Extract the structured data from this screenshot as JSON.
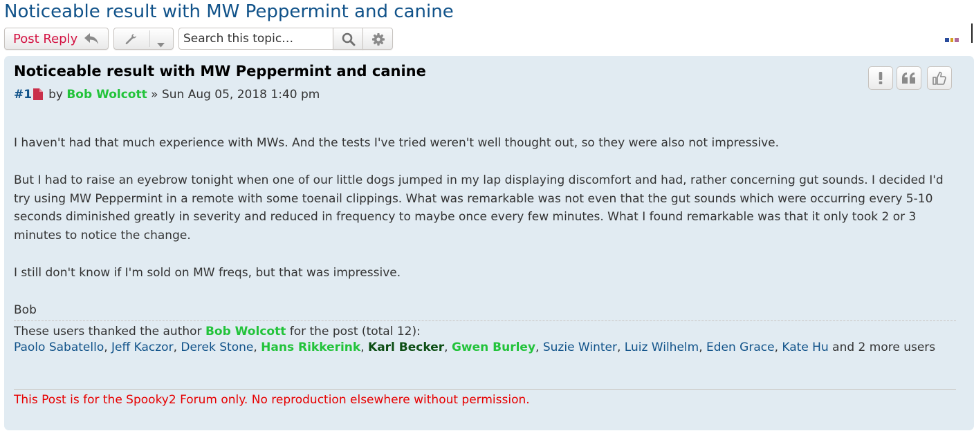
{
  "topic": {
    "title": "Noticeable result with MW Peppermint and canine"
  },
  "toolbar": {
    "post_reply_label": "Post Reply",
    "reply_icon": "reply-arrow-icon",
    "tools_icon": "wrench-icon",
    "search_placeholder": "Search this topic…",
    "search_icon": "magnifier-icon",
    "advanced_search_icon": "gear-icon"
  },
  "post": {
    "title": "Noticeable result with MW Peppermint and canine",
    "number": "#1",
    "by_label": "by",
    "author": "Bob Wolcott",
    "date_separator": "»",
    "date": "Sun Aug 05, 2018 1:40 pm",
    "actions": [
      "report-icon",
      "quote-icon",
      "thumbs-up-icon"
    ],
    "paragraphs": [
      "I haven't had that much experience with MWs. And the tests I've tried weren't well thought out, so they were also not impressive.",
      "But I had to raise an eyebrow tonight when one of our little dogs jumped in my lap displaying discomfort and had, rather concerning gut sounds. I decided I'd try using MW Peppermint in a remote with some toenail clippings. What was remarkable was not even that the gut sounds which were occurring every 5-10 seconds diminished greatly in severity and reduced in frequency to maybe once every few minutes. What I found remarkable was that it only took 2 or 3 minutes to notice the change.",
      "I still don't know if I'm sold on MW freqs, but that was impressive."
    ],
    "signature": "Bob"
  },
  "thanks": {
    "prefix": "These users thanked the author",
    "author": "Bob Wolcott",
    "suffix": "for the post (total 12):",
    "users": [
      {
        "name": "Paolo Sabatello",
        "style": "blue"
      },
      {
        "name": "Jeff Kaczor",
        "style": "blue"
      },
      {
        "name": "Derek Stone",
        "style": "blue"
      },
      {
        "name": "Hans Rikkerink",
        "style": "green"
      },
      {
        "name": "Karl Becker",
        "style": "dark"
      },
      {
        "name": "Gwen Burley",
        "style": "green"
      },
      {
        "name": "Suzie Winter",
        "style": "blue"
      },
      {
        "name": "Luiz Wilhelm",
        "style": "blue"
      },
      {
        "name": "Eden Grace",
        "style": "blue"
      },
      {
        "name": "Kate Hu",
        "style": "blue"
      }
    ],
    "and_label": "and",
    "more_count": "2",
    "more_label": "more users"
  },
  "notice": "This Post is for the Spooky2 Forum only. No reproduction elsewhere without permission.",
  "colors": {
    "link": "#105289",
    "author": "#22c33a",
    "dark_user": "#0b4d13",
    "reply": "#d31141",
    "notice": "#e60000",
    "post_bg": "#e1ebf2"
  }
}
